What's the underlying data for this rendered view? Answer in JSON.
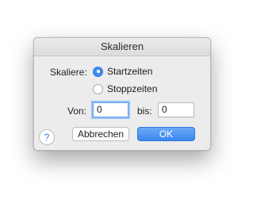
{
  "dialog": {
    "title": "Skalieren",
    "scale_label": "Skaliere:",
    "options": [
      {
        "label": "Startzeiten",
        "selected": true
      },
      {
        "label": "Stoppzeiten",
        "selected": false
      }
    ],
    "from_label": "Von:",
    "from_value": "0",
    "to_label": "bis:",
    "to_value": "0",
    "cancel_label": "Abbrechen",
    "ok_label": "OK",
    "help_icon": "?"
  },
  "colors": {
    "accent": "#3f8cf0",
    "dialog_bg": "#ececec"
  }
}
